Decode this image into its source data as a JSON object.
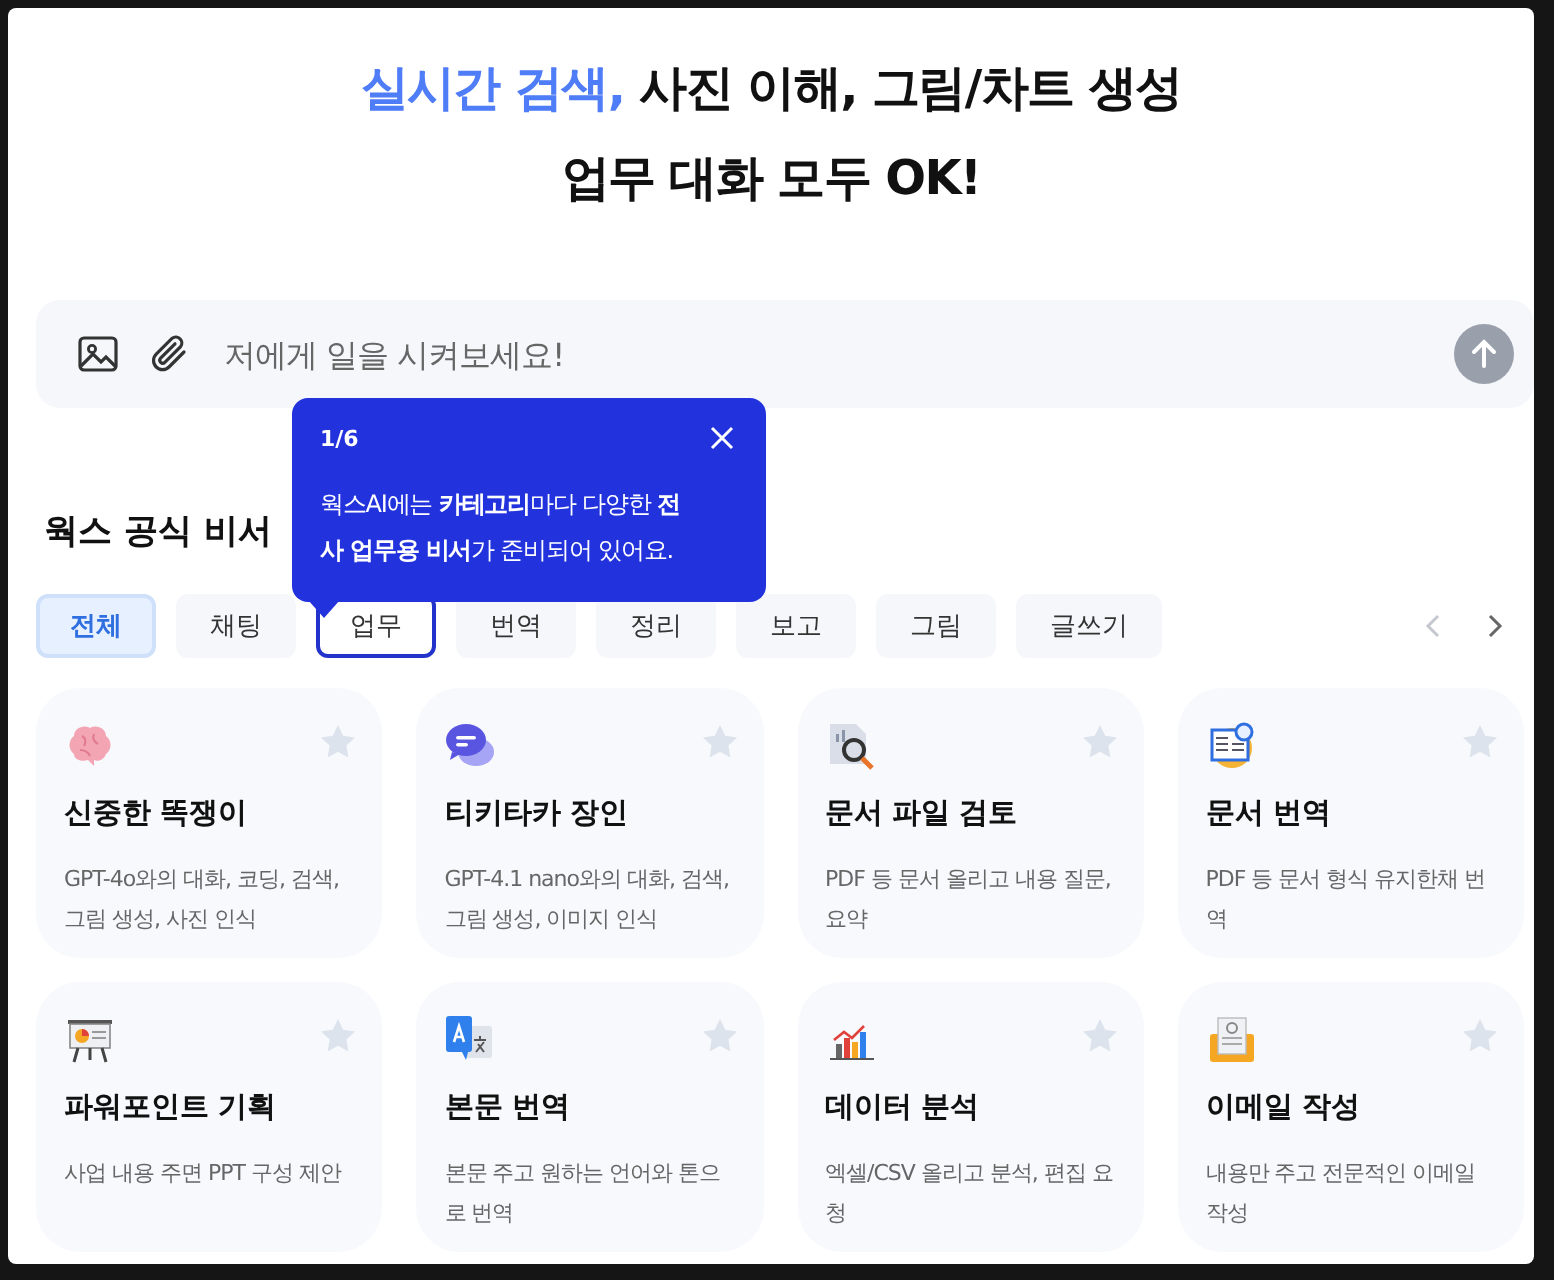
{
  "headline": [
    {
      "parts": [
        {
          "text": "실시간 검색,",
          "highlight": true
        },
        {
          "text": " 사진 이해, 그림/차트 생성",
          "highlight": false
        }
      ]
    },
    {
      "parts": [
        {
          "text": "업무 대화 모두 OK!",
          "highlight": false
        }
      ]
    }
  ],
  "prompt": {
    "placeholder": "저에게 일을 시켜보세요!"
  },
  "tooltip": {
    "step": "1/6",
    "text": "웍스AI에는 **카테고리**마다 다양한 **전사 업무용 비서**가 준비되어 있어요."
  },
  "section_title": "웍스 공식 비서",
  "categories": [
    {
      "label": "전체",
      "selected": true,
      "focused": false
    },
    {
      "label": "채팅",
      "selected": false,
      "focused": false
    },
    {
      "label": "업무",
      "selected": false,
      "focused": true
    },
    {
      "label": "번역",
      "selected": false,
      "focused": false
    },
    {
      "label": "정리",
      "selected": false,
      "focused": false
    },
    {
      "label": "보고",
      "selected": false,
      "focused": false
    },
    {
      "label": "그림",
      "selected": false,
      "focused": false
    },
    {
      "label": "글쓰기",
      "selected": false,
      "focused": false
    }
  ],
  "nav": {
    "prev_disabled": true,
    "next_disabled": false
  },
  "assistants": [
    {
      "kind": "brain",
      "title": "신중한 똑쟁이",
      "description": "GPT-4o와의 대화, 코딩, 검색, 그림 생성, 사진 인식",
      "favorite": false
    },
    {
      "kind": "chat",
      "title": "티키타카 장인",
      "description": "GPT-4.1 nano와의 대화, 검색, 그림 생성, 이미지 인식",
      "favorite": false
    },
    {
      "kind": "doc-search",
      "title": "문서 파일 검토",
      "description": "PDF 등 문서 올리고 내용 질문, 요약",
      "favorite": false
    },
    {
      "kind": "doc-translate",
      "title": "문서 번역",
      "description": "PDF 등 문서 형식 유지한채 번역",
      "favorite": false
    },
    {
      "kind": "presentation",
      "title": "파워포인트 기획",
      "description": "사업 내용 주면 PPT 구성 제안",
      "favorite": false
    },
    {
      "kind": "translate",
      "title": "본문 번역",
      "description": "본문 주고 원하는 언어와 톤으로 번역",
      "favorite": false
    },
    {
      "kind": "chart",
      "title": "데이터 분석",
      "description": "엑셀/CSV 올리고 분석, 편집 요청",
      "favorite": false
    },
    {
      "kind": "email",
      "title": "이메일 작성",
      "description": "내용만 주고 전문적인 이메일 작성",
      "favorite": false
    }
  ]
}
